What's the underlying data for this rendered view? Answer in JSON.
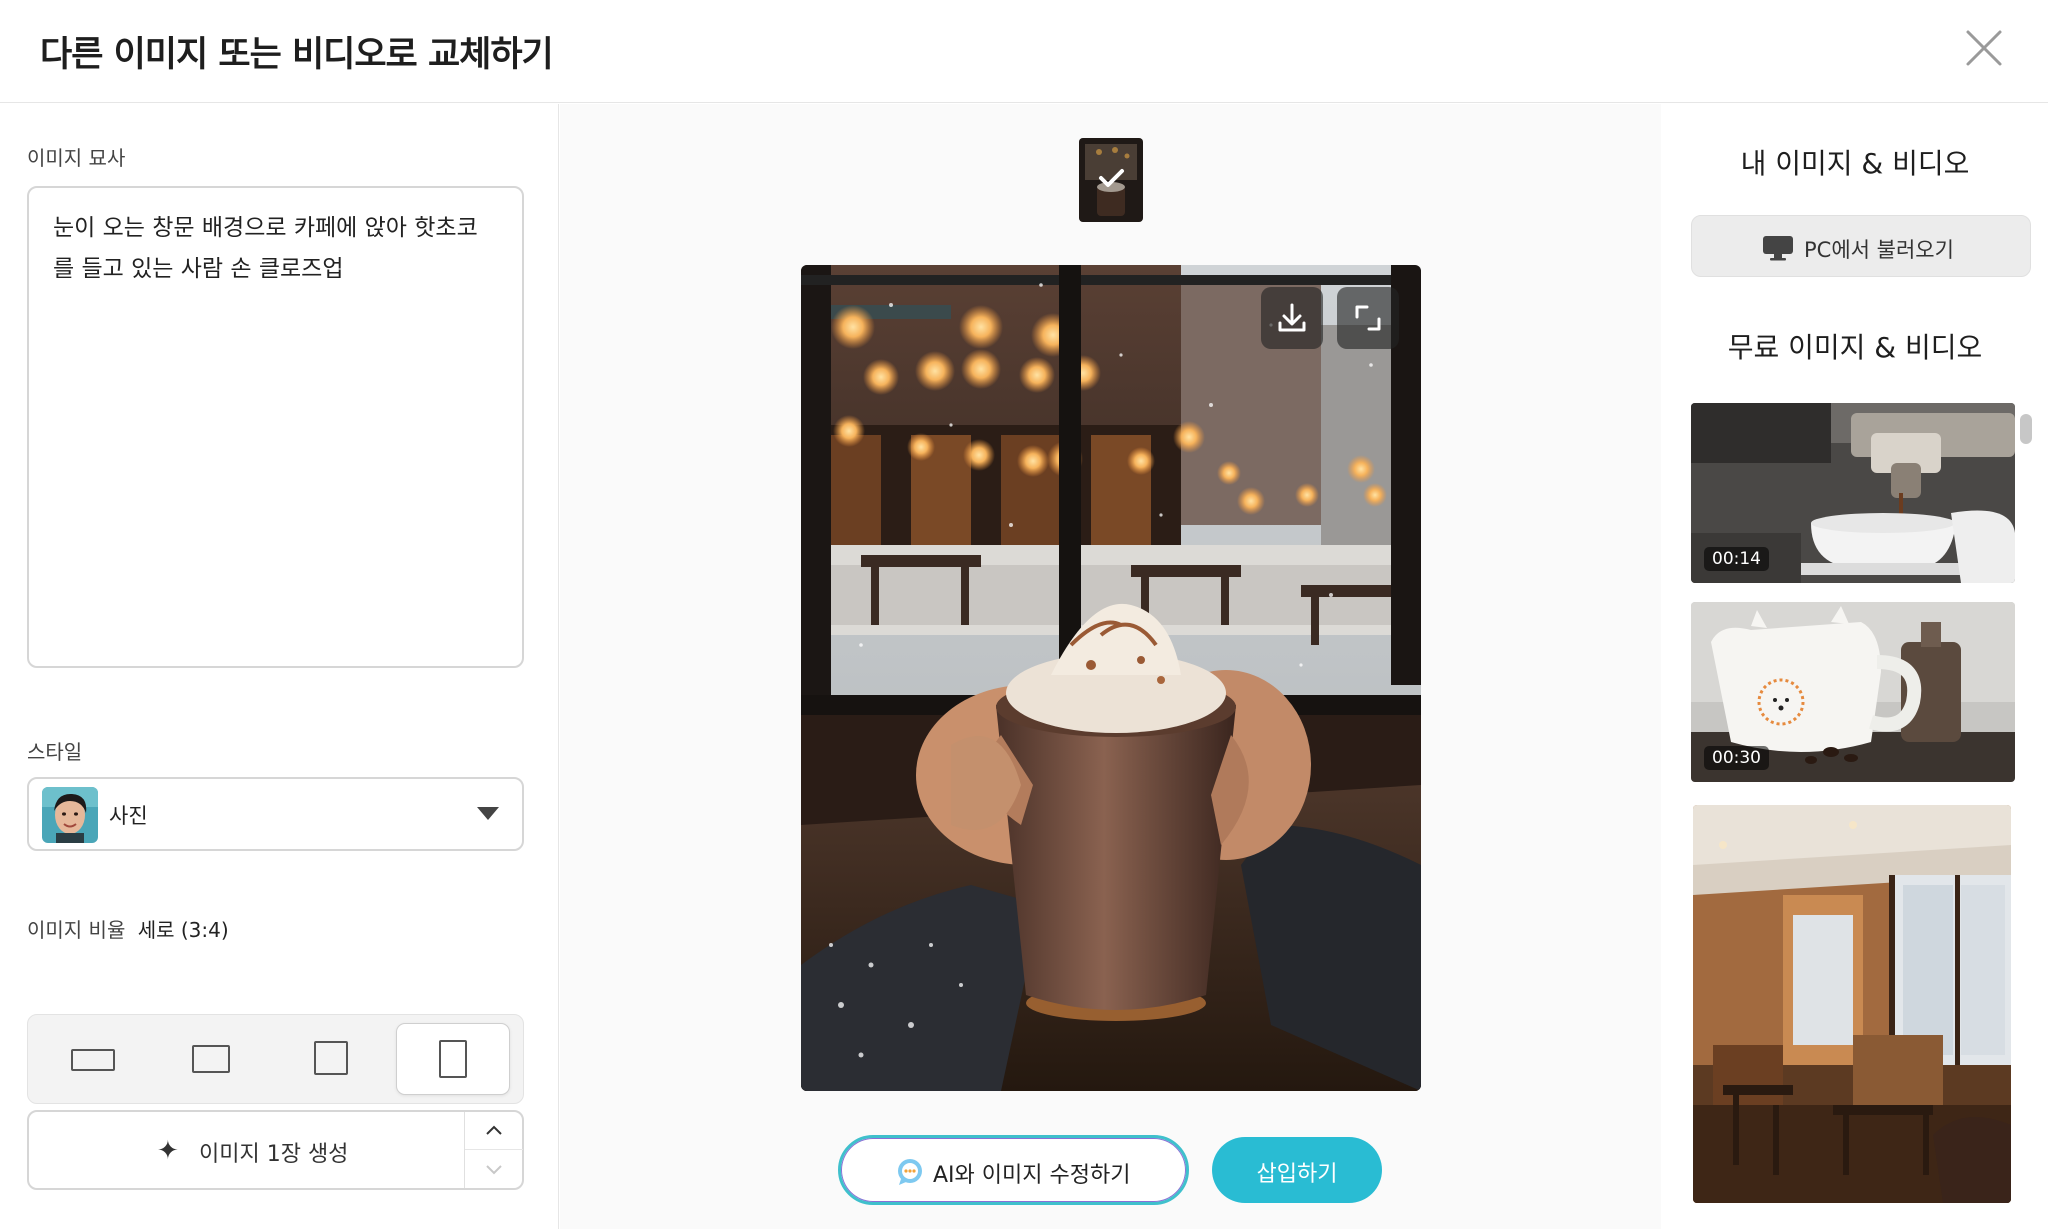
{
  "dialog": {
    "title": "다른 이미지 또는 비디오로 교체하기"
  },
  "left": {
    "description_label": "이미지 묘사",
    "description_value": "눈이 오는 창문 배경으로 카페에 앉아 핫초코를 들고 있는 사람 손 클로즈업",
    "style_label": "스타일",
    "style_value": "사진",
    "ratio_label": "이미지 비율",
    "ratio_value": "세로 (3:4)",
    "ratio_options": [
      "wide",
      "landscape",
      "square",
      "portrait"
    ],
    "ratio_selected": "portrait",
    "generate_label": "이미지 1장 생성"
  },
  "center": {
    "ai_edit_label": "AI와 이미지 수정하기",
    "insert_label": "삽입하기"
  },
  "right": {
    "my_media_title": "내 이미지 & 비디오",
    "load_pc_label": "PC에서 불러오기",
    "free_media_title": "무료 이미지 & 비디오",
    "items": [
      {
        "duration": "00:14",
        "kind": "video"
      },
      {
        "duration": "00:30",
        "kind": "video"
      },
      {
        "duration": "",
        "kind": "image"
      }
    ]
  },
  "colors": {
    "accent": "#29bcd3",
    "ai_border": "#3fc0cc",
    "text": "#222222"
  }
}
